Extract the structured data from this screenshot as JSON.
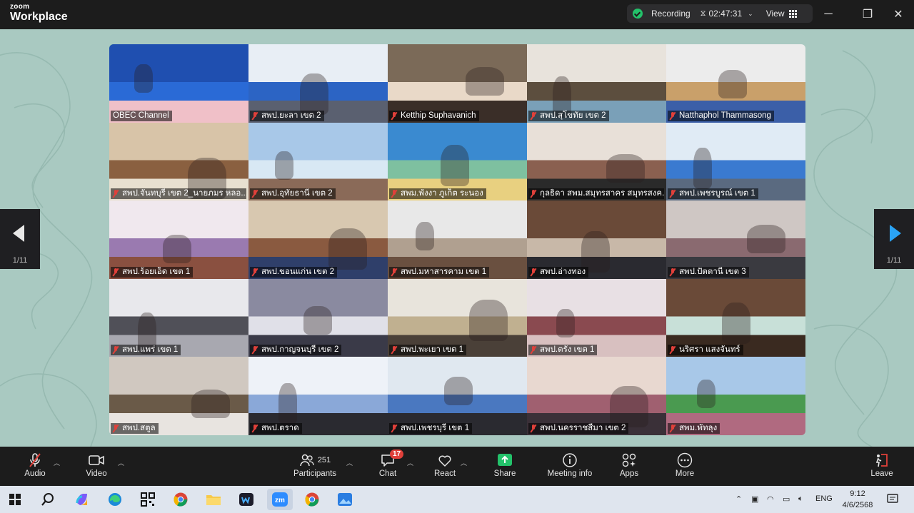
{
  "app": {
    "brand_top": "zoom",
    "brand_bottom": "Workplace"
  },
  "recording": {
    "label": "Recording",
    "timer": "02:47:31",
    "view_label": "View"
  },
  "gallery": {
    "page_indicator_left": "1/11",
    "page_indicator_right": "1/11",
    "tiles": [
      {
        "name": "OBEC Channel",
        "muted": false,
        "active": true
      },
      {
        "name": "สพป.ยะลา เขต 2",
        "muted": true
      },
      {
        "name": "Ketthip Suphavanich",
        "muted": true
      },
      {
        "name": "สพป.สุโขทัย เขต 2",
        "muted": true
      },
      {
        "name": "Natthaphol Thammasong",
        "muted": true
      },
      {
        "name": "สพป.จันทบุรี เขต 2_นายภมร หลอ...",
        "muted": true
      },
      {
        "name": "สพป.อุทัยธานี เขต 2",
        "muted": true
      },
      {
        "name": "สพม.พังงา ภูเก็ต ระนอง",
        "muted": true
      },
      {
        "name": "กุลธิดา สพม.สมุทรสาคร สมุทรสงค...",
        "muted": true
      },
      {
        "name": "สพป.เพชรบูรณ์ เขต 1",
        "muted": true
      },
      {
        "name": "สพป.ร้อยเอ็ด เขต 1",
        "muted": true
      },
      {
        "name": "สพป.ขอนแก่น เขต 2",
        "muted": true
      },
      {
        "name": "สพป.มหาสารคาม เขต 1",
        "muted": true
      },
      {
        "name": "สพป.อ่างทอง",
        "muted": true
      },
      {
        "name": "สพป.ปัตตานี เขต 3",
        "muted": true
      },
      {
        "name": "สพป.แพร่ เขต 1",
        "muted": true
      },
      {
        "name": "สพป.กาญจนบุรี เขต 2",
        "muted": true
      },
      {
        "name": "สพป.พะเยา เขต 1",
        "muted": true
      },
      {
        "name": "สพป.ตรัง เขต 1",
        "muted": true
      },
      {
        "name": "นริศรา แสงจันทร์",
        "muted": true
      },
      {
        "name": "สพป.สตูล",
        "muted": true
      },
      {
        "name": "สพป.ตราด",
        "muted": true
      },
      {
        "name": "สพป.เพชรบุรี เขต 1",
        "muted": true
      },
      {
        "name": "สพป.นครราชสีมา เขต 2",
        "muted": true
      },
      {
        "name": "สพม.พัทลุง",
        "muted": true
      }
    ]
  },
  "toolbar": {
    "audio": "Audio",
    "video": "Video",
    "participants": "Participants",
    "participants_count": "251",
    "chat": "Chat",
    "chat_badge": "17",
    "react": "React",
    "share": "Share",
    "meeting_info": "Meeting info",
    "apps": "Apps",
    "more": "More",
    "leave": "Leave"
  },
  "taskbar": {
    "lang": "ENG",
    "time": "9:12",
    "date": "4/6/2568"
  },
  "colors": {
    "accent_green": "#23c26a",
    "active_outline": "#39d353",
    "leave_red": "#e0403a",
    "chat_badge": "#e0403a",
    "stage_bg": "#a9c9c1"
  }
}
